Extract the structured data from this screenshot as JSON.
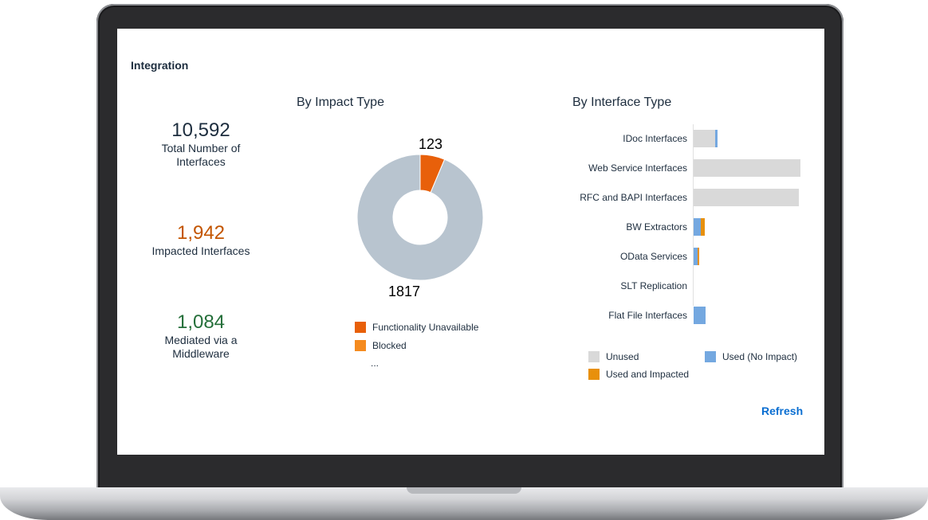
{
  "card": {
    "title": "Integration"
  },
  "kpis": [
    {
      "value": "10,592",
      "label_line1": "Total Number of",
      "label_line2": "Interfaces",
      "color": "#1d2d3e"
    },
    {
      "value": "1,942",
      "label_line1": "Impacted Interfaces",
      "label_line2": "",
      "color": "#c35500"
    },
    {
      "value": "1,084",
      "label_line1": "Mediated via a",
      "label_line2": "Middleware",
      "color": "#256f3a"
    }
  ],
  "impact": {
    "title": "By Impact Type",
    "legend": [
      {
        "label": "Functionality Unavailable",
        "color": "#e8600a"
      },
      {
        "label": "Blocked",
        "color": "#f58b1f"
      }
    ],
    "legend_more": "..."
  },
  "interface_type": {
    "title": "By Interface Type",
    "legend": [
      {
        "label": "Unused",
        "color": "#d9d9d9"
      },
      {
        "label": "Used (No Impact)",
        "color": "#74a8e0"
      },
      {
        "label": "Used and Impacted",
        "color": "#e8900c"
      }
    ]
  },
  "refresh_label": "Refresh",
  "chart_data": [
    {
      "type": "pie",
      "title": "By Impact Type",
      "slices": [
        {
          "label": "Functionality Unavailable",
          "value": 123,
          "color": "#e8600a"
        },
        {
          "label": "",
          "value": 1817,
          "color": "#b8c4cf"
        }
      ],
      "data_labels": [
        "123",
        "1817"
      ],
      "donut": true
    },
    {
      "type": "bar",
      "orientation": "horizontal",
      "stacked": true,
      "title": "By Interface Type",
      "categories": [
        "IDoc Interfaces",
        "Web Service Interfaces",
        "RFC and BAPI Interfaces",
        "BW Extractors",
        "OData Services",
        "SLT Replication",
        "Flat File Interfaces"
      ],
      "series": [
        {
          "name": "Unused",
          "color": "#d9d9d9",
          "values": [
            600,
            2950,
            2900,
            0,
            0,
            0,
            0
          ]
        },
        {
          "name": "Used (No Impact)",
          "color": "#74a8e0",
          "values": [
            60,
            0,
            0,
            200,
            100,
            0,
            320
          ]
        },
        {
          "name": "Used and Impacted",
          "color": "#e8900c",
          "values": [
            0,
            0,
            0,
            100,
            40,
            0,
            0
          ]
        }
      ],
      "xlim": [
        0,
        2950
      ],
      "legend": "bottom"
    }
  ]
}
